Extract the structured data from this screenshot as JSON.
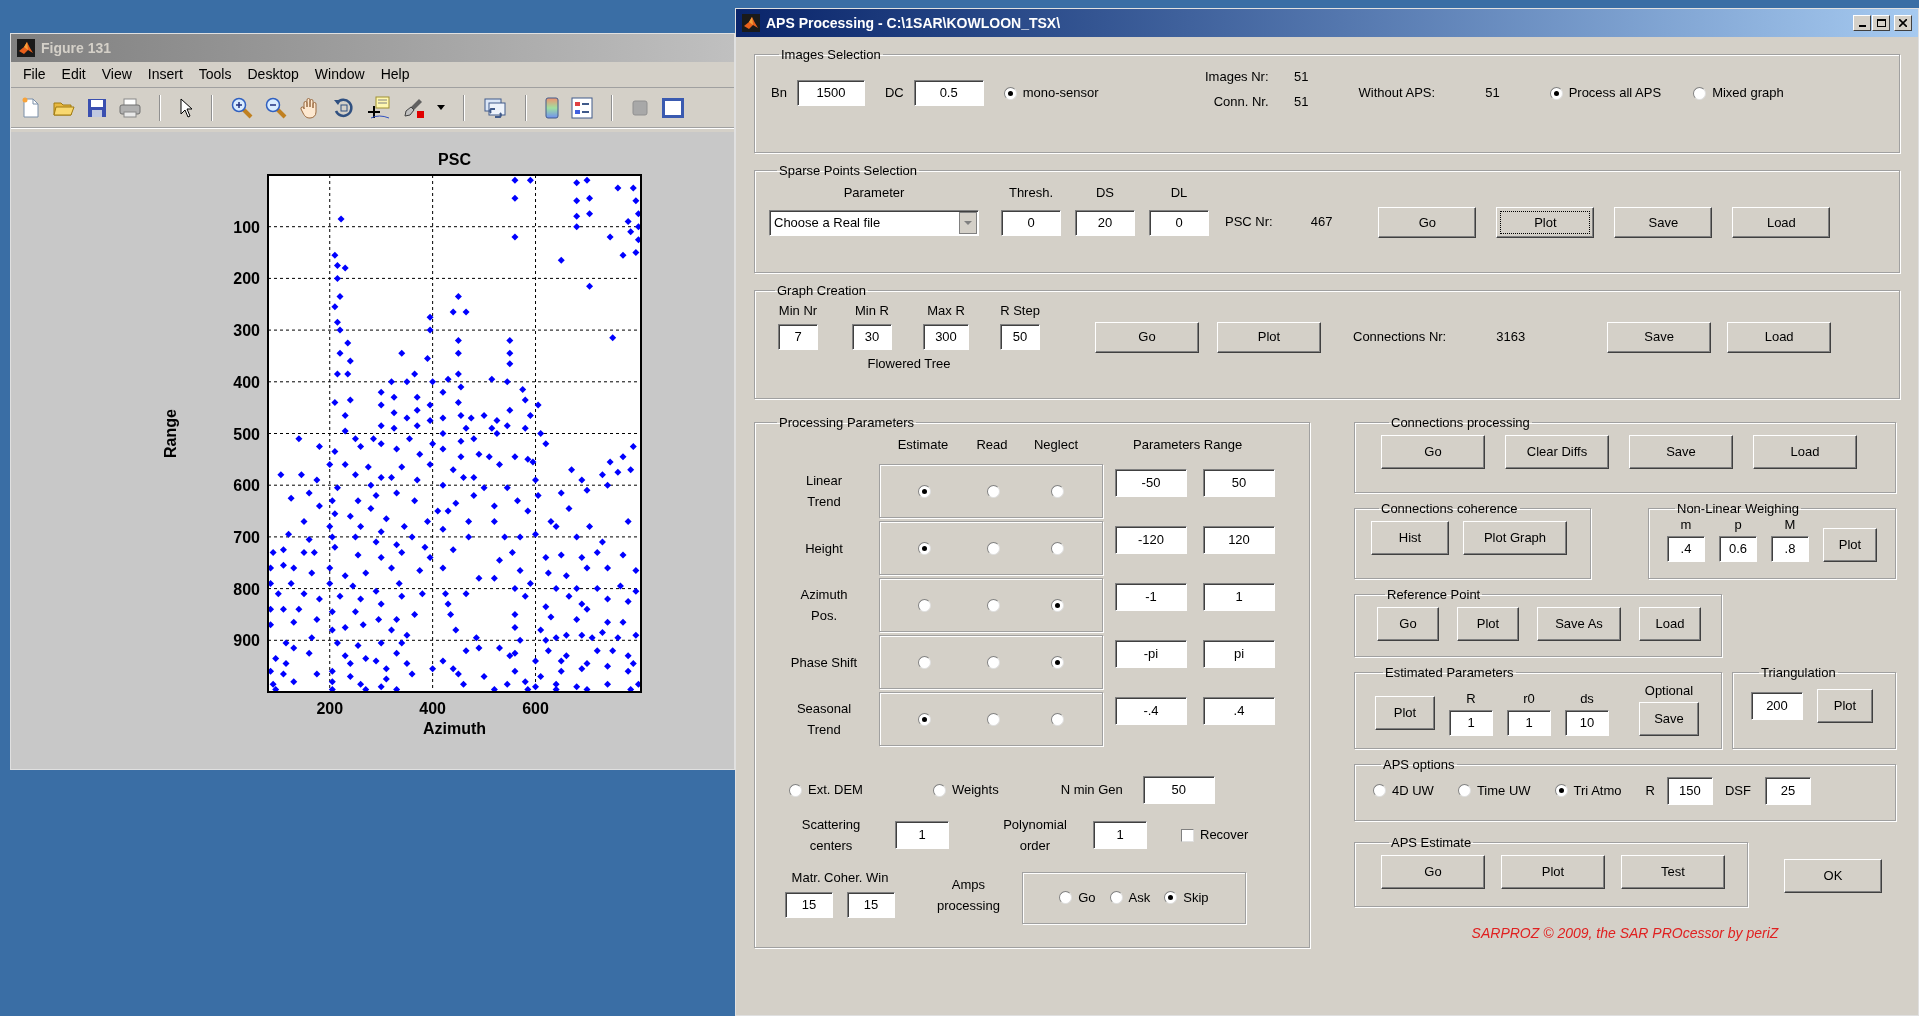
{
  "figure_window": {
    "title": "Figure 131",
    "active": false,
    "menu": [
      "File",
      "Edit",
      "View",
      "Insert",
      "Tools",
      "Desktop",
      "Window",
      "Help"
    ],
    "chart_data": {
      "type": "scatter",
      "title": "PSC",
      "xlabel": "Azimuth",
      "ylabel": "Range",
      "xlim": [
        80,
        805
      ],
      "ylim": [
        1000,
        0
      ],
      "xticks": [
        200,
        400,
        600
      ],
      "yticks": [
        100,
        200,
        300,
        400,
        500,
        600,
        700,
        800,
        900
      ],
      "x": [
        560,
        590,
        560,
        560,
        680,
        700,
        680,
        705,
        680,
        705,
        680,
        760,
        790,
        795,
        800,
        780,
        800,
        785,
        745,
        800,
        770,
        795,
        650,
        705,
        750,
        222,
        210,
        215,
        230,
        215,
        220,
        210,
        215,
        220,
        220,
        235,
        240,
        215,
        235,
        210,
        240,
        230,
        230,
        450,
        440,
        465,
        395,
        395,
        450,
        450,
        340,
        390,
        550,
        550,
        550,
        450,
        365,
        350,
        320,
        400,
        430,
        455,
        515,
        545,
        575,
        300,
        325,
        370,
        420,
        450,
        580,
        605,
        300,
        395,
        325,
        550,
        350,
        370,
        420,
        455,
        475,
        500,
        525,
        590,
        300,
        325,
        370,
        395,
        465,
        515,
        545,
        580,
        610,
        140,
        250,
        285,
        355,
        400,
        420,
        455,
        480,
        525,
        620,
        790,
        180,
        210,
        260,
        300,
        330,
        375,
        420,
        455,
        490,
        510,
        560,
        585,
        770,
        200,
        230,
        275,
        300,
        340,
        395,
        440,
        480,
        530,
        595,
        745,
        785,
        105,
        145,
        175,
        215,
        250,
        280,
        320,
        370,
        420,
        460,
        500,
        545,
        600,
        670,
        690,
        730,
        760,
        125,
        160,
        205,
        255,
        290,
        330,
        365,
        410,
        445,
        480,
        520,
        565,
        605,
        650,
        700,
        740,
        180,
        210,
        240,
        280,
        310,
        345,
        390,
        430,
        470,
        520,
        585,
        630,
        665,
        705,
        780,
        150,
        200,
        260,
        300,
        360,
        420,
        470,
        540,
        600,
        640,
        680,
        730,
        120,
        160,
        205,
        250,
        290,
        330,
        385,
        440,
        570,
        90,
        110,
        150,
        170,
        210,
        255,
        300,
        340,
        395,
        530,
        555,
        620,
        650,
        690,
        720,
        770,
        85,
        110,
        130,
        165,
        200,
        230,
        270,
        320,
        375,
        420,
        490,
        520,
        570,
        625,
        660,
        700,
        740,
        795,
        85,
        125,
        200,
        245,
        290,
        335,
        380,
        425,
        465,
        560,
        590,
        640,
        680,
        720,
        765,
        795,
        100,
        150,
        180,
        220,
        260,
        300,
        340,
        430,
        580,
        620,
        665,
        690,
        740,
        780,
        85,
        110,
        140,
        175,
        205,
        250,
        295,
        330,
        365,
        435,
        560,
        630,
        680,
        700,
        740,
        770,
        85,
        130,
        205,
        230,
        265,
        320,
        350,
        445,
        560,
        610,
        640,
        690,
        730,
        795,
        115,
        165,
        215,
        255,
        300,
        340,
        485,
        570,
        620,
        660,
        710,
        760,
        130,
        160,
        230,
        290,
        330,
        465,
        490,
        530,
        560,
        625,
        660,
        720,
        750,
        780,
        95,
        115,
        240,
        270,
        310,
        350,
        420,
        440,
        550,
        600,
        650,
        700,
        740,
        790,
        85,
        110,
        175,
        205,
        240,
        310,
        360,
        400,
        450,
        500,
        560,
        610,
        650,
        690,
        780,
        90,
        130,
        205,
        260,
        300,
        330,
        460,
        545,
        580,
        600,
        640,
        680,
        740,
        800,
        95,
        205,
        270,
        520,
        585,
        640,
        700,
        785
      ],
      "grid": true,
      "series": [
        {
          "color": "#0000ff",
          "values": [
            10,
            10,
            45,
            120,
            15,
            10,
            50,
            45,
            80,
            75,
            100,
            25,
            25,
            50,
            75,
            90,
            100,
            110,
            120,
            125,
            155,
            150,
            165,
            215,
            315,
            85,
            155,
            175,
            180,
            200,
            235,
            255,
            285,
            300,
            345,
            325,
            360,
            385,
            385,
            440,
            435,
            465,
            495,
            235,
            265,
            265,
            275,
            300,
            320,
            345,
            345,
            355,
            320,
            345,
            365,
            385,
            385,
            400,
            400,
            400,
            395,
            410,
            395,
            400,
            415,
            420,
            430,
            430,
            420,
            440,
            435,
            445,
            445,
            445,
            460,
            455,
            470,
            455,
            470,
            465,
            470,
            465,
            475,
            465,
            485,
            490,
            485,
            475,
            490,
            490,
            485,
            490,
            500,
            510,
            510,
            510,
            510,
            520,
            500,
            515,
            510,
            500,
            520,
            525,
            525,
            535,
            525,
            520,
            530,
            540,
            530,
            545,
            540,
            545,
            545,
            550,
            545,
            560,
            560,
            565,
            585,
            565,
            560,
            570,
            585,
            560,
            555,
            555,
            570,
            580,
            580,
            590,
            605,
            580,
            600,
            585,
            590,
            600,
            585,
            605,
            605,
            590,
            570,
            590,
            580,
            575,
            625,
            615,
            630,
            630,
            620,
            615,
            630,
            650,
            635,
            620,
            640,
            630,
            620,
            615,
            610,
            600,
            640,
            655,
            660,
            645,
            665,
            680,
            670,
            650,
            670,
            670,
            650,
            670,
            645,
            680,
            670,
            670,
            680,
            680,
            690,
            700,
            685,
            700,
            700,
            695,
            680,
            700,
            710,
            695,
            705,
            700,
            700,
            710,
            715,
            720,
            725,
            700,
            730,
            725,
            730,
            730,
            720,
            735,
            740,
            730,
            740,
            745,
            730,
            740,
            735,
            740,
            730,
            735,
            760,
            755,
            760,
            770,
            760,
            775,
            770,
            760,
            765,
            760,
            780,
            780,
            765,
            770,
            775,
            760,
            760,
            765,
            790,
            790,
            790,
            795,
            805,
            790,
            810,
            810,
            810,
            800,
            790,
            800,
            800,
            800,
            795,
            805,
            810,
            810,
            820,
            815,
            820,
            830,
            815,
            830,
            815,
            835,
            815,
            830,
            820,
            825,
            840,
            840,
            840,
            860,
            845,
            845,
            860,
            860,
            850,
            850,
            850,
            855,
            860,
            840,
            865,
            865,
            870,
            865,
            880,
            875,
            870,
            880,
            890,
            880,
            875,
            880,
            895,
            890,
            885,
            890,
            905,
            895,
            905,
            910,
            905,
            905,
            895,
            900,
            900,
            890,
            895,
            895,
            915,
            925,
            930,
            940,
            925,
            920,
            915,
            915,
            925,
            920,
            930,
            920,
            920,
            930,
            935,
            945,
            945,
            935,
            955,
            945,
            940,
            955,
            930,
            940,
            940,
            945,
            950,
            945,
            960,
            965,
            965,
            960,
            970,
            975,
            965,
            955,
            965,
            970,
            960,
            970,
            960,
            955,
            960,
            985,
            980,
            980,
            985,
            990,
            995,
            985,
            985,
            980,
            990,
            985,
            990,
            985,
            985,
            995,
            995,
            995,
            995,
            995,
            995,
            995,
            995
          ]
        }
      ]
    }
  },
  "aps_window": {
    "title": "APS Processing - C:\\1SAR\\KOWLOON_TSX\\",
    "active": true,
    "images_selection": {
      "title": "Images Selection",
      "bn_label": "Bn",
      "bn": "1500",
      "dc_label": "DC",
      "dc": "0.5",
      "mono_sensor": {
        "label": "mono-sensor",
        "selected": true
      },
      "images_nr_label": "Images Nr:",
      "images_nr": "51",
      "conn_nr_label": "Conn. Nr.",
      "conn_nr": "51",
      "without_aps_label": "Without APS:",
      "without_aps": "51",
      "process_all": {
        "label": "Process all APS",
        "selected": true
      },
      "mixed_graph": {
        "label": "Mixed graph",
        "selected": false
      }
    },
    "sparse_points": {
      "title": "Sparse Points Selection",
      "headers": [
        "Parameter",
        "Thresh.",
        "DS",
        "DL"
      ],
      "parameter": "Choose a Real file",
      "values": [
        "0",
        "20",
        "0"
      ],
      "psc_nr_label": "PSC Nr:",
      "psc_nr": "467",
      "buttons": [
        {
          "label": "Go",
          "focused": false
        },
        {
          "label": "Plot",
          "focused": true
        },
        {
          "label": "Save",
          "focused": false
        },
        {
          "label": "Load",
          "focused": false
        }
      ]
    },
    "graph_creation": {
      "title": "Graph Creation",
      "headers": [
        "Min Nr",
        "Min R",
        "Max R",
        "R Step"
      ],
      "values": [
        "7",
        "30",
        "300",
        "50"
      ],
      "note": "Flowered Tree",
      "buttons": [
        "Go",
        "Plot"
      ],
      "connections_nr_label": "Connections Nr:",
      "connections_nr": "3163",
      "file_buttons": [
        "Save",
        "Load"
      ]
    },
    "processing_parameters": {
      "title": "Processing Parameters",
      "columns": [
        "Estimate",
        "Read",
        "Neglect"
      ],
      "range_header": "Parameters Range",
      "rows": [
        {
          "label": "Linear\nTrend",
          "options": [
            {
              "selected": true
            },
            {
              "selected": false
            },
            {
              "selected": false
            }
          ],
          "range": [
            "-50",
            "50"
          ]
        },
        {
          "label": "Height",
          "options": [
            {
              "selected": true
            },
            {
              "selected": false
            },
            {
              "selected": false
            }
          ],
          "range": [
            "-120",
            "120"
          ]
        },
        {
          "label": "Azimuth\nPos.",
          "options": [
            {
              "selected": false
            },
            {
              "selected": false
            },
            {
              "selected": true
            }
          ],
          "range": [
            "-1",
            "1"
          ]
        },
        {
          "label": "Phase Shift",
          "options": [
            {
              "selected": false
            },
            {
              "selected": false
            },
            {
              "selected": true
            }
          ],
          "range": [
            "-pi",
            "pi"
          ]
        },
        {
          "label": "Seasonal\nTrend",
          "options": [
            {
              "selected": true
            },
            {
              "selected": false
            },
            {
              "selected": false
            }
          ],
          "range": [
            "-.4",
            ".4"
          ]
        }
      ],
      "ext_dem": {
        "label": "Ext. DEM",
        "selected": false
      },
      "weights": {
        "label": "Weights",
        "selected": false
      },
      "n_min_gen_label": "N min Gen",
      "n_min_gen": "50",
      "scattering_label": "Scattering\ncenters",
      "scattering": "1",
      "polynomial_label": "Polynomial\norder",
      "polynomial": "1",
      "recover": {
        "label": "Recover",
        "checked": false
      },
      "coher_win_label": "Matr. Coher. Win",
      "coher_win": [
        "15",
        "15"
      ],
      "amps_label": "Amps\nprocessing",
      "amps_options": [
        {
          "label": "Go",
          "selected": false
        },
        {
          "label": "Ask",
          "selected": false
        },
        {
          "label": "Skip",
          "selected": true
        }
      ]
    },
    "connections_processing": {
      "title": "Connections processing",
      "buttons": [
        "Go",
        "Clear Diffs",
        "Save",
        "Load"
      ]
    },
    "connections_coherence": {
      "title": "Connections coherence",
      "buttons": [
        "Hist",
        "Plot Graph"
      ]
    },
    "non_linear_weighing": {
      "title": "Non-Linear Weighing",
      "params": [
        {
          "label": "m",
          "value": ".4"
        },
        {
          "label": "p",
          "value": "0.6"
        },
        {
          "label": "M",
          "value": ".8"
        }
      ],
      "button": "Plot"
    },
    "reference_point": {
      "title": "Reference Point",
      "buttons": [
        "Go",
        "Plot",
        "Save As",
        "Load"
      ]
    },
    "estimated_parameters": {
      "title": "Estimated Parameters",
      "button": "Plot",
      "params": [
        {
          "label": "R",
          "value": "1"
        },
        {
          "label": "r0",
          "value": "1"
        },
        {
          "label": "ds",
          "value": "10"
        }
      ],
      "optional_label": "Optional",
      "save_button": "Save"
    },
    "triangulation": {
      "title": "Triangulation",
      "value": "200",
      "button": "Plot"
    },
    "aps_options": {
      "title": "APS options",
      "modes": [
        {
          "label": "4D UW",
          "selected": false
        },
        {
          "label": "Time UW",
          "selected": false
        },
        {
          "label": "Tri Atmo",
          "selected": true
        }
      ],
      "r_label": "R",
      "r": "150",
      "dsf_label": "DSF",
      "dsf": "25"
    },
    "aps_estimate": {
      "title": "APS Estimate",
      "buttons": [
        "Go",
        "Plot",
        "Test"
      ]
    },
    "ok_button": "OK",
    "footer": "SARPROZ © 2009, the SAR PROcessor by periZ"
  }
}
